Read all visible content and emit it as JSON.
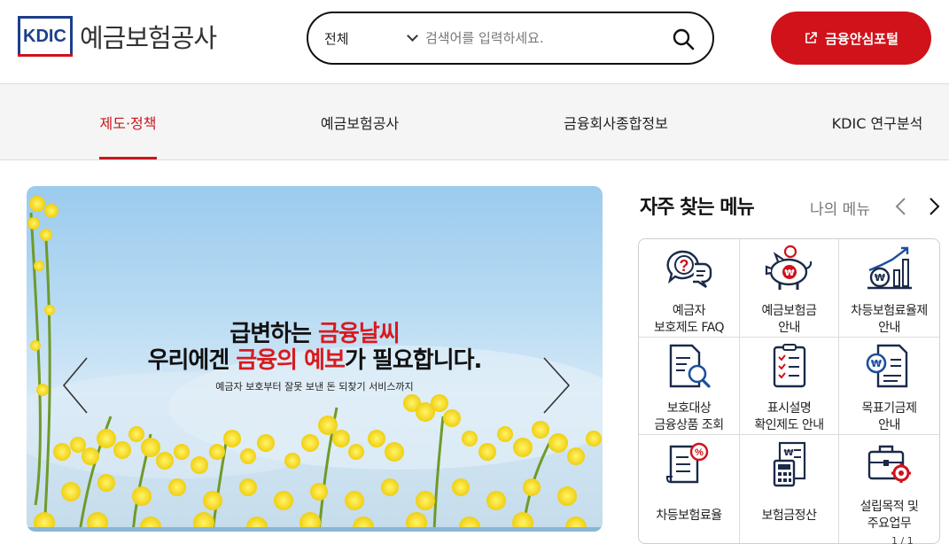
{
  "header": {
    "logo_mark": "KDIC",
    "logo_text": "예금보험공사",
    "search": {
      "scope": "전체",
      "placeholder": "검색어를 입력하세요."
    },
    "portal_button": "금융안심포털"
  },
  "nav": {
    "items": [
      {
        "label": "제도·정책",
        "active": true
      },
      {
        "label": "예금보험공사",
        "active": false
      },
      {
        "label": "금융회사종합정보",
        "active": false
      },
      {
        "label": "KDIC 연구분석",
        "active": false
      }
    ]
  },
  "banner": {
    "line1_a": "급변하는 ",
    "line1_b": "금융날씨",
    "line2_a": "우리에겐 ",
    "line2_b": "금융의 예보",
    "line2_c": "가 필요합니다.",
    "subtitle": "예금자 보호부터 잘못 보낸 돈 되찾기 서비스까지"
  },
  "favorites": {
    "title": "자주 찾는 메뉴",
    "my_menu": "나의 메뉴",
    "items": [
      {
        "label": "예금자\n보호제도 FAQ",
        "icon": "faq-chat-icon"
      },
      {
        "label": "예금보험금\n안내",
        "icon": "piggy-bank-icon"
      },
      {
        "label": "차등보험료율제\n안내",
        "icon": "growth-chart-coin-icon"
      },
      {
        "label": "보호대상\n금융상품 조회",
        "icon": "document-search-icon"
      },
      {
        "label": "표시설명\n확인제도 안내",
        "icon": "checklist-icon"
      },
      {
        "label": "목표기금제\n안내",
        "icon": "fund-document-icon"
      },
      {
        "label": "차등보험료율",
        "icon": "percent-document-icon"
      },
      {
        "label": "보험금정산",
        "icon": "calculator-icon"
      },
      {
        "label": "설립목적 및\n주요업무",
        "icon": "briefcase-gear-icon"
      }
    ],
    "page_indicator": "1 / 1"
  },
  "colors": {
    "brand_red": "#d0121b",
    "brand_blue": "#1c3f8c",
    "icon_navy": "#1b2a4a"
  }
}
